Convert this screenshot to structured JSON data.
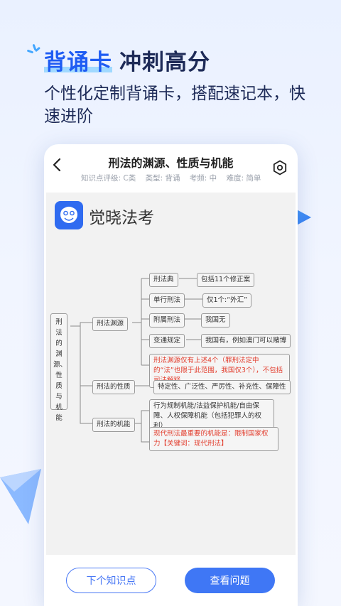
{
  "headline": {
    "highlight": "背诵卡",
    "rest": "冲刺高分"
  },
  "subtitle": "个性化定制背诵卡，搭配速记本，快速进阶",
  "card": {
    "title": "刑法的渊源、性质与机能",
    "meta": {
      "level": "知识点评级: C类",
      "type": "类型: 背诵",
      "frequency": "考频: 中",
      "difficulty": "难度: 简单"
    }
  },
  "logo": {
    "text": "觉晓法考"
  },
  "mindmap": {
    "root": "刑法的渊源、性质与机能",
    "branches": {
      "source": "刑法渊源",
      "nature": "刑法的性质",
      "function": "刑法的机能"
    },
    "source_items": {
      "code": "刑法典",
      "single": "单行刑法",
      "attached": "附属刑法",
      "adapted": "变通规定"
    },
    "source_details": {
      "code": "包括11个修正案",
      "single": "仅1个:“外汇”",
      "attached": "我国无",
      "adapted": "我国有，例如澳门可以赌博"
    },
    "source_note": "刑法渊源仅有上述4个（罪刑法定中的“法”也限于此范围，我国仅3个），不包括司法解释",
    "nature_detail": "特定性、广泛性、严厉性、补充性、保障性",
    "function_detail": "行为规制机能/法益保护机能/自由保障、人权保障机能（包括犯罪人的权利）",
    "function_note": "现代刑法最重要的机能是：限制国家权力【关键词：现代刑法】"
  },
  "buttons": {
    "next": "下个知识点",
    "view": "查看问题"
  },
  "colors": {
    "accent": "#3f77f5",
    "red": "#e23b2b",
    "headline": "#1d2a57"
  },
  "icons": [
    "sparkle-icon",
    "back-icon",
    "settings-icon",
    "logo-icon",
    "play-triangle-icon",
    "paper-plane-icon"
  ]
}
